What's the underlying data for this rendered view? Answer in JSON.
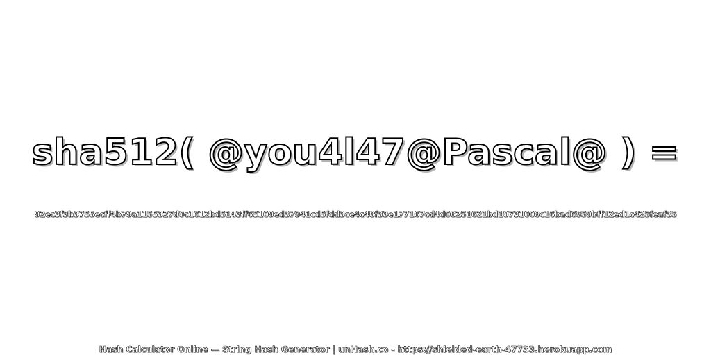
{
  "heading": {
    "text": "sha512( @you4l47@Pascal@ ) ="
  },
  "hash_output": {
    "text": "92ec3f3b3755ecff4b79a1155327d0c1612bd5143ff65109ed37941cd5fdd3ce4c48f33e177167cd4d08251621bd10731008c16bad6859bff12ed1c425feaf35"
  },
  "footer": {
    "text": "Hash Calculator Online — String Hash Generator | unHash.co - https://shielded-earth-47733.herokuapp.com"
  },
  "colors": {
    "background": "#ffffff",
    "text_fill": "#ffffff",
    "text_outline": "#000000",
    "text_shadow": "#b4b4b4"
  }
}
